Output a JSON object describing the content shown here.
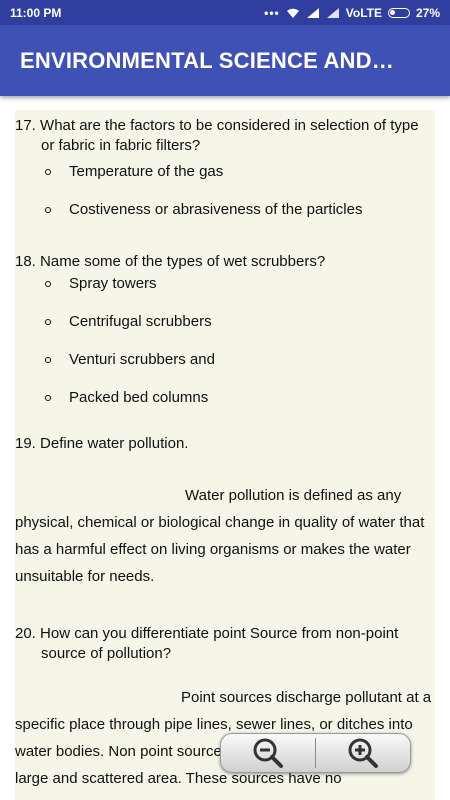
{
  "status": {
    "time": "11:00 PM",
    "network": "VoLTE",
    "battery": "27%"
  },
  "appbar": {
    "title": "ENVIRONMENTAL SCIENCE AND…"
  },
  "questions": [
    {
      "num": "17.",
      "text": "What are the factors to be considered in selection of type or fabric in fabric filters?",
      "bullets": [
        "Temperature of the gas",
        "Costiveness or abrasiveness of the particles"
      ]
    },
    {
      "num": "18.",
      "text": "Name some of the types of wet scrubbers?",
      "bullets": [
        "Spray towers",
        "Centrifugal scrubbers",
        "Venturi scrubbers and",
        "Packed bed columns"
      ]
    },
    {
      "num": "19.",
      "text": "Define water pollution.",
      "answer": "Water pollution is defined as any physical, chemical or biological change in quality of water that has a harmful effect on living organisms or makes the water unsuitable for needs."
    },
    {
      "num": "20.",
      "text": "How can you differentiate point Source from non-point source of pollution?",
      "answer": "Point sources discharge pollutant at a specific place through pipe lines, sewer lines, or ditches into water bodies. Non point sources discharge pollutants from large and scattered area. These sources have no"
    }
  ],
  "zoom": {
    "out_icon": "zoom-out-icon",
    "in_icon": "zoom-in-icon"
  }
}
